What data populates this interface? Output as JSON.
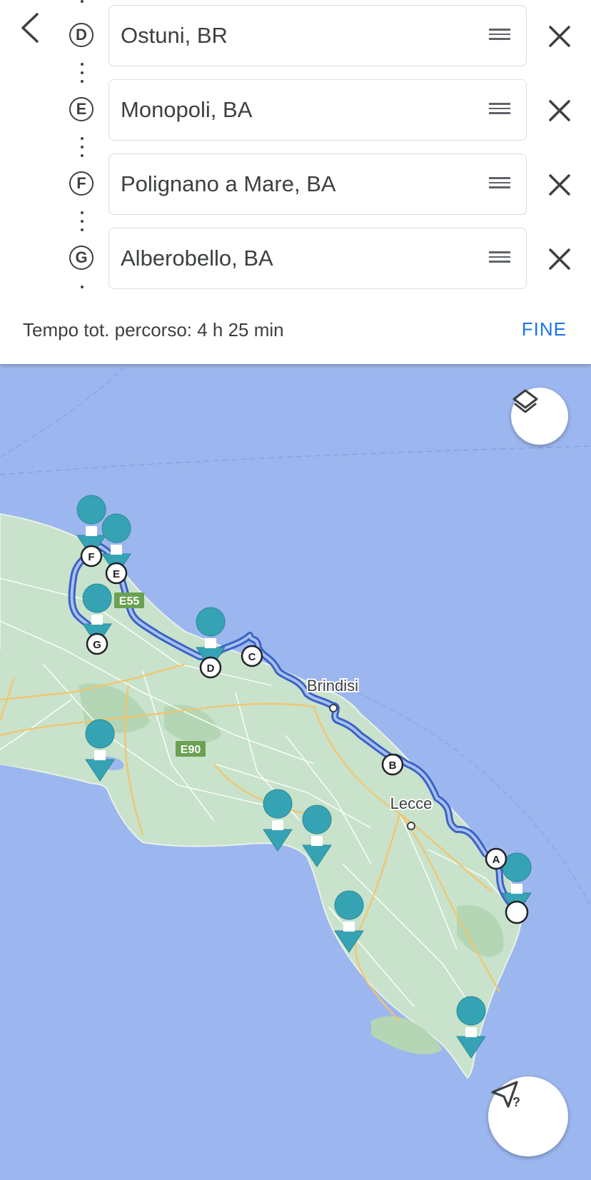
{
  "header": {
    "stops": [
      {
        "letter": "D",
        "place": "Ostuni, BR"
      },
      {
        "letter": "E",
        "place": "Monopoli, BA"
      },
      {
        "letter": "F",
        "place": "Polignano a Mare, BA"
      },
      {
        "letter": "G",
        "place": "Alberobello, BA"
      }
    ],
    "total_time": "Tempo tot. percorso: 4 h 25 min",
    "done_label": "FINE"
  },
  "map": {
    "city_labels": [
      "Brindisi",
      "Lecce"
    ],
    "road_shields": [
      "E55",
      "E90"
    ],
    "route_markers": [
      "A",
      "B",
      "C",
      "D",
      "E",
      "F",
      "G"
    ],
    "colors": {
      "sea": "#9cb6ef",
      "land": "#c8e2cb",
      "route": "#4a78d6",
      "pin": "#36a3b5",
      "shield": "#6aa152"
    }
  },
  "controls": {
    "layers_icon": "layers-icon",
    "navigate_icon": "navigate-help-icon"
  }
}
